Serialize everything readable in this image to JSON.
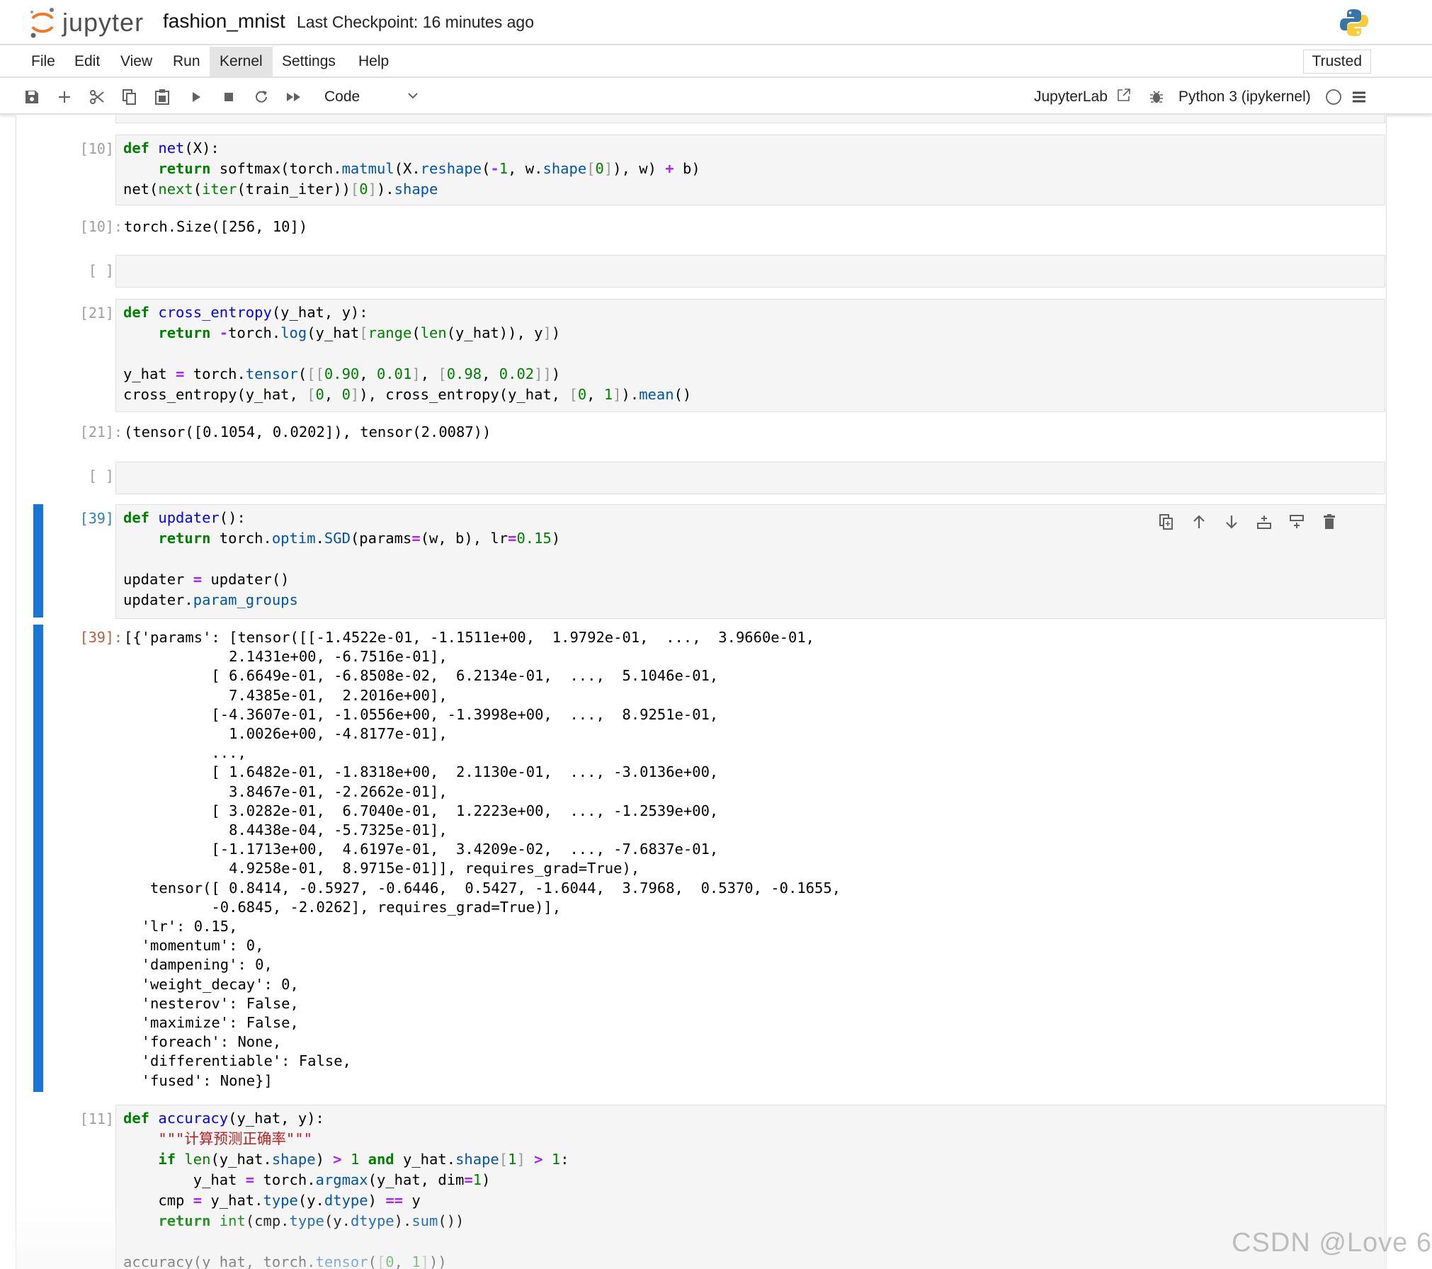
{
  "header": {
    "logo_text": "jupyter",
    "notebook_title": "fashion_mnist",
    "checkpoint": "Last Checkpoint: 16 minutes ago"
  },
  "menu": {
    "items": [
      "File",
      "Edit",
      "View",
      "Run",
      "Kernel",
      "Settings",
      "Help"
    ],
    "active": "Kernel",
    "trusted": "Trusted"
  },
  "toolbar": {
    "cell_type": "Code",
    "jupyterlab_link": "JupyterLab",
    "kernel_name": "Python 3 (ipykernel)"
  },
  "cells": [
    {
      "prompt": "[10]:",
      "output_prompt": "[10]:"
    },
    {
      "prompt": "[ ]:"
    },
    {
      "prompt": "[21]:",
      "output_prompt": "[21]:"
    },
    {
      "prompt": "[ ]:"
    },
    {
      "prompt": "[39]:",
      "output_prompt": "[39]:"
    },
    {
      "prompt": "[11]:"
    }
  ],
  "outputs": {
    "out10": "torch.Size([256, 10])",
    "out21": "(tensor([0.1054, 0.0202]), tensor(2.0087))",
    "out39": "[{'params': [tensor([[-1.4522e-01, -1.1511e+00,  1.9792e-01,  ...,  3.9660e-01,\n            2.1431e+00, -6.7516e-01],\n          [ 6.6649e-01, -6.8508e-02,  6.2134e-01,  ...,  5.1046e-01,\n            7.4385e-01,  2.2016e+00],\n          [-4.3607e-01, -1.0556e+00, -1.3998e+00,  ...,  8.9251e-01,\n            1.0026e+00, -4.8177e-01],\n          ...,\n          [ 1.6482e-01, -1.8318e+00,  2.1130e-01,  ..., -3.0136e+00,\n            3.8467e-01, -2.2662e-01],\n          [ 3.0282e-01,  6.7040e-01,  1.2223e+00,  ..., -1.2539e+00,\n            8.4438e-04, -5.7325e-01],\n          [-1.1713e+00,  4.6197e-01,  3.4209e-02,  ..., -7.6837e-01,\n            4.9258e-01,  8.9715e-01]], requires_grad=True),\n   tensor([ 0.8414, -0.5927, -0.6446,  0.5427, -1.6044,  3.7968,  0.5370, -0.1655,\n          -0.6845, -2.0262], requires_grad=True)],\n  'lr': 0.15,\n  'momentum': 0,\n  'dampening': 0,\n  'weight_decay': 0,\n  'nesterov': False,\n  'maximize': False,\n  'foreach': None,\n  'differentiable': False,\n  'fused': None}]"
  },
  "icons": {
    "toolbar": [
      "save-icon",
      "add-icon",
      "cut-icon",
      "copy-icon",
      "paste-icon",
      "run-icon",
      "stop-icon",
      "restart-icon",
      "run-all-icon"
    ],
    "cell_tools": [
      "duplicate-icon",
      "move-up-icon",
      "move-down-icon",
      "insert-above-icon",
      "insert-below-icon",
      "delete-icon"
    ]
  },
  "colors": {
    "active_cell": "#1976d2",
    "keyword": "#008000",
    "function": "#0000ff",
    "operator": "#aa22ff",
    "string": "#ba2121",
    "out_prompt_active": "#bf5b3d",
    "in_prompt_active": "#307fc1"
  },
  "watermark": "CSDN @Love 6"
}
